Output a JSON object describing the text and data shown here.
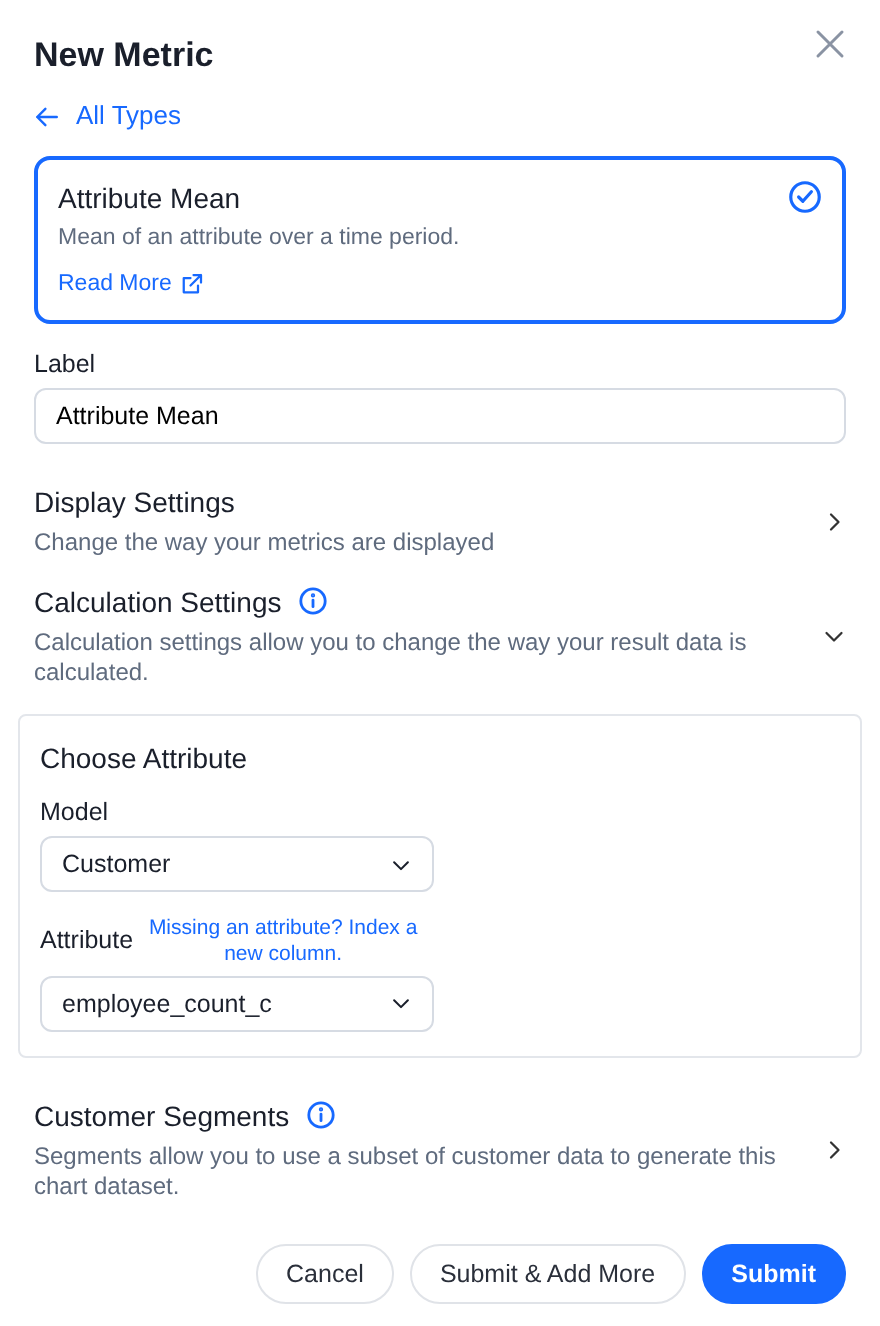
{
  "dialog": {
    "title": "New Metric"
  },
  "back_link": "All Types",
  "metric_type": {
    "title": "Attribute Mean",
    "description": "Mean of an attribute over a time period.",
    "link": "Read More",
    "selected": true
  },
  "label_field": {
    "label": "Label",
    "value": "Attribute Mean"
  },
  "sections": [
    {
      "title": "Display Settings",
      "description": "Change the way your metrics are displayed",
      "info": false,
      "expanded": false
    },
    {
      "title": "Calculation Settings",
      "description": "Calculation settings allow you to change the way your result data is calculated.",
      "info": true,
      "expanded": true
    }
  ],
  "choose_attribute": {
    "title": "Choose Attribute",
    "model": {
      "label": "Model",
      "value": "Customer"
    },
    "attribute": {
      "label": "Attribute",
      "hint_link": "Missing an attribute? Index a new column.",
      "value": "employee_count_c"
    }
  },
  "segments": {
    "title": "Customer Segments",
    "description": "Segments allow you to use a subset of customer data to generate this chart dataset.",
    "info": true,
    "expanded": false
  },
  "buttons": [
    {
      "label": "Cancel",
      "kind": "secondary"
    },
    {
      "label": "Submit & Add More",
      "kind": "secondary"
    },
    {
      "label": "Submit",
      "kind": "primary"
    }
  ]
}
